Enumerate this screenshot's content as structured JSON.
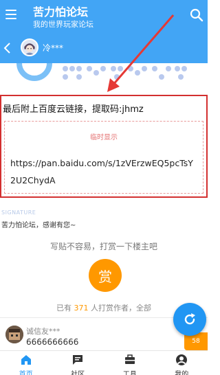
{
  "app": {
    "title": "苦力怕论坛",
    "subtitle": "我的世界玩家论坛"
  },
  "thread": {
    "author": "冷***"
  },
  "post": {
    "content_text": "最后附上百度云链接，提取码:jhmz",
    "reveal_title": "临时显示",
    "reveal_link": "https://pan.baidu.com/s/1zVErzwEQ5pcTsY2U2ChydA"
  },
  "signature": {
    "label": "SIGNATURE",
    "text": "苦力怕论坛，感谢有您~"
  },
  "reward": {
    "prompt": "写贴不容易，打赏一下楼主吧",
    "button_label": "赏",
    "count_prefix": "已有",
    "count": "371",
    "count_suffix": "人打赏作者，全部"
  },
  "comment": {
    "user": "诚信友***",
    "text": "6666666666",
    "badge": "58"
  },
  "nav": {
    "items": [
      {
        "label": "首页",
        "icon": "home-icon"
      },
      {
        "label": "社区",
        "icon": "chat-icon"
      },
      {
        "label": "工具",
        "icon": "toolbox-icon"
      },
      {
        "label": "我的",
        "icon": "person-icon"
      }
    ]
  },
  "colors": {
    "primary": "#42a5f5",
    "accent": "#ff9800",
    "highlight_border": "#d32f2f",
    "fab": "#2196f3"
  }
}
